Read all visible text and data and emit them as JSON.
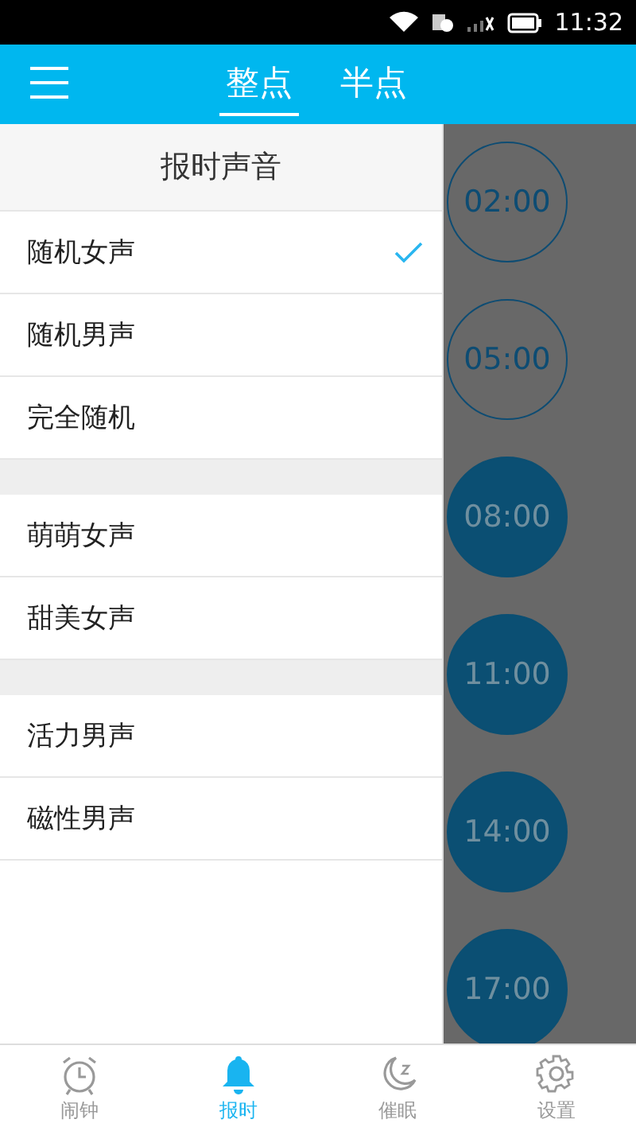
{
  "status_bar": {
    "time": "11:32"
  },
  "header": {
    "tabs": [
      {
        "label": "整点",
        "selected": true
      },
      {
        "label": "半点",
        "selected": false
      }
    ]
  },
  "drawer": {
    "title": "报时声音",
    "groups": [
      {
        "items": [
          {
            "label": "随机女声",
            "selected": true
          },
          {
            "label": "随机男声",
            "selected": false
          },
          {
            "label": "完全随机",
            "selected": false
          }
        ]
      },
      {
        "items": [
          {
            "label": "萌萌女声",
            "selected": false
          },
          {
            "label": "甜美女声",
            "selected": false
          }
        ]
      },
      {
        "items": [
          {
            "label": "活力男声",
            "selected": false
          },
          {
            "label": "磁性男声",
            "selected": false
          }
        ]
      }
    ]
  },
  "times": [
    {
      "label": "02:00",
      "on": false
    },
    {
      "label": "05:00",
      "on": false
    },
    {
      "label": "08:00",
      "on": true
    },
    {
      "label": "11:00",
      "on": true
    },
    {
      "label": "14:00",
      "on": true
    },
    {
      "label": "17:00",
      "on": true
    }
  ],
  "bottom_nav": [
    {
      "kind": "alarm",
      "label": "闹钟",
      "selected": false
    },
    {
      "kind": "bell",
      "label": "报时",
      "selected": true
    },
    {
      "kind": "sleep",
      "label": "催眠",
      "selected": false
    },
    {
      "kind": "settings",
      "label": "设置",
      "selected": false
    }
  ]
}
